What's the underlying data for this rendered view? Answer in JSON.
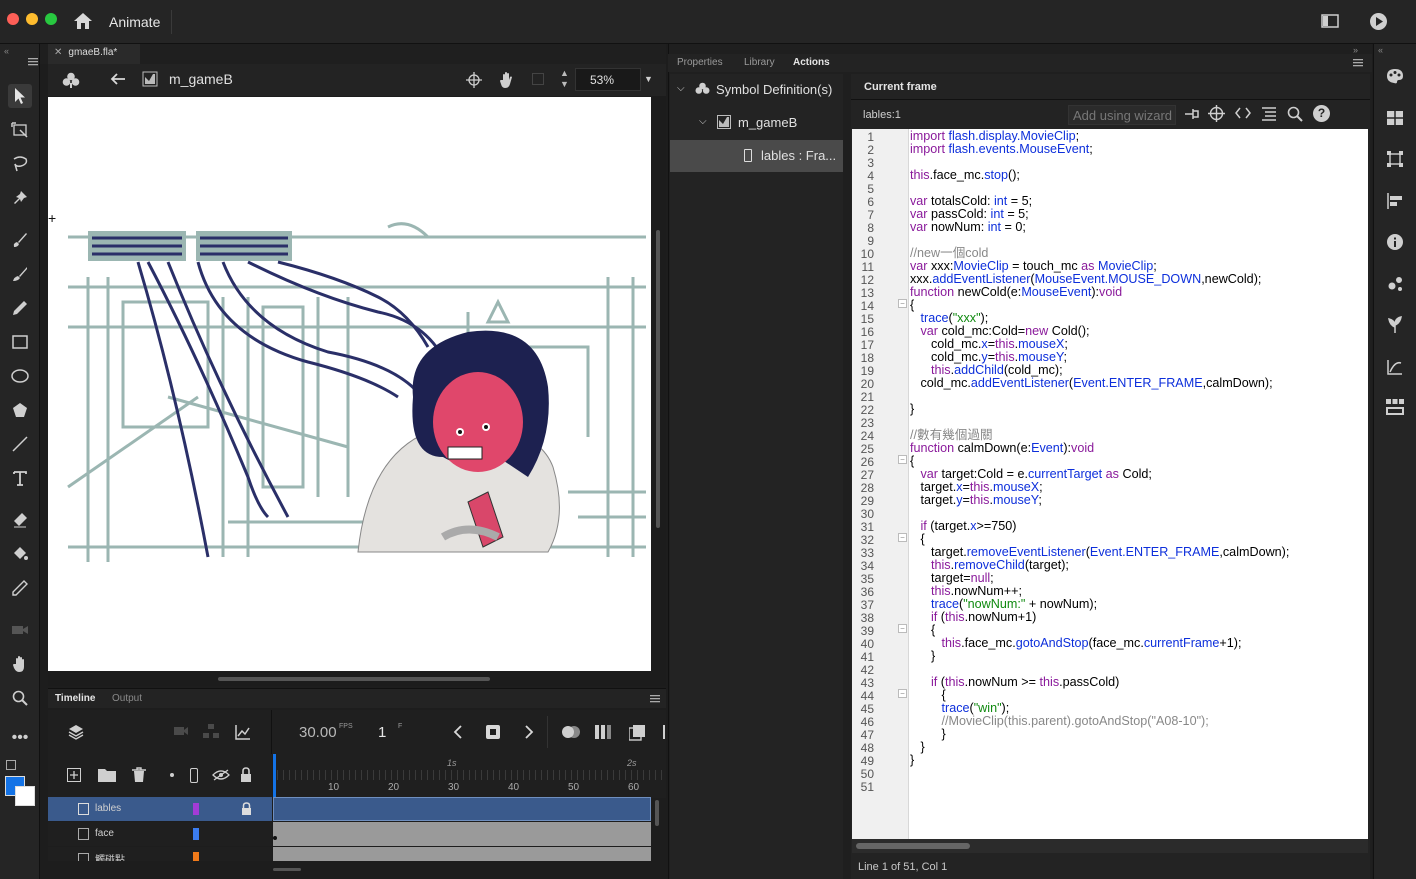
{
  "app": {
    "name": "Animate"
  },
  "document": {
    "tab": "gmaeB.fla*"
  },
  "editbar": {
    "symbol_name": "m_gameB",
    "zoom": "53%"
  },
  "timeline": {
    "tabs": [
      "Timeline",
      "Output"
    ],
    "fps": "30.00",
    "fps_unit": "FPS",
    "frame": "1",
    "frame_unit": "F",
    "ruler_seconds": [
      "1s",
      "2s"
    ],
    "ruler_frames": [
      "10",
      "20",
      "30",
      "40",
      "50",
      "60"
    ],
    "layers": [
      {
        "name": "lables",
        "color": "#a23bd6",
        "locked": true,
        "selected": true
      },
      {
        "name": "face",
        "color": "#3b7df0",
        "locked": false,
        "selected": false
      },
      {
        "name": "觸碰點",
        "color": "#f07a1a",
        "locked": false,
        "selected": false
      }
    ]
  },
  "panels": {
    "tabs": [
      "Properties",
      "Library",
      "Actions"
    ],
    "active": "Actions"
  },
  "tree": {
    "root": "Symbol Definition(s)",
    "child": "m_gameB",
    "leaf": "lables : Fra..."
  },
  "actions": {
    "header": "Current frame",
    "frame_label": "lables:1",
    "wizard": "Add using wizard",
    "status": "Line 1 of 51, Col 1",
    "line_count": 51
  },
  "code_lines": [
    [
      [
        "import ",
        "k"
      ],
      [
        "flash.display.MovieClip",
        "b"
      ],
      [
        ";",
        ""
      ]
    ],
    [
      [
        "import ",
        "k"
      ],
      [
        "flash.events.MouseEvent",
        "b"
      ],
      [
        ";",
        ""
      ]
    ],
    [],
    [
      [
        "this",
        "k"
      ],
      [
        ".face_mc.",
        ""
      ],
      [
        "stop",
        "b"
      ],
      [
        "();",
        ""
      ]
    ],
    [],
    [
      [
        "var ",
        "k"
      ],
      [
        "totalsCold: ",
        ""
      ],
      [
        "int",
        "b"
      ],
      [
        " = 5;",
        ""
      ]
    ],
    [
      [
        "var ",
        "k"
      ],
      [
        "passCold: ",
        ""
      ],
      [
        "int",
        "b"
      ],
      [
        " = 5;",
        ""
      ]
    ],
    [
      [
        "var ",
        "k"
      ],
      [
        "nowNum: ",
        ""
      ],
      [
        "int",
        "b"
      ],
      [
        " = 0;",
        ""
      ]
    ],
    [],
    [
      [
        "//new一個cold",
        "c"
      ]
    ],
    [
      [
        "var ",
        "k"
      ],
      [
        "xxx:",
        ""
      ],
      [
        "MovieClip",
        "b"
      ],
      [
        " = touch_mc ",
        ""
      ],
      [
        "as ",
        "k"
      ],
      [
        "MovieClip",
        "b"
      ],
      [
        ";",
        ""
      ]
    ],
    [
      [
        "xxx.",
        ""
      ],
      [
        "addEventListener",
        "b"
      ],
      [
        "(",
        ""
      ],
      [
        "MouseEvent.MOUSE_DOWN",
        "b"
      ],
      [
        ",newCold);",
        ""
      ]
    ],
    [
      [
        "function ",
        "k"
      ],
      [
        "newCold(e:",
        ""
      ],
      [
        "MouseEvent",
        "b"
      ],
      [
        "):",
        ""
      ],
      [
        "void",
        "k"
      ]
    ],
    [
      [
        "{",
        ""
      ]
    ],
    [
      [
        "   ",
        ""
      ],
      [
        "trace",
        "b"
      ],
      [
        "(",
        ""
      ],
      [
        "\"xxx\"",
        "g"
      ],
      [
        ");",
        ""
      ]
    ],
    [
      [
        "   ",
        ""
      ],
      [
        "var ",
        "k"
      ],
      [
        "cold_mc:Cold=",
        ""
      ],
      [
        "new ",
        "k"
      ],
      [
        "Cold();",
        ""
      ]
    ],
    [
      [
        "      cold_mc.",
        ""
      ],
      [
        "x",
        "b"
      ],
      [
        "=",
        ""
      ],
      [
        "this",
        "k"
      ],
      [
        ".",
        ""
      ],
      [
        "mouseX",
        "b"
      ],
      [
        ";",
        ""
      ]
    ],
    [
      [
        "      cold_mc.",
        ""
      ],
      [
        "y",
        "b"
      ],
      [
        "=",
        ""
      ],
      [
        "this",
        "k"
      ],
      [
        ".",
        ""
      ],
      [
        "mouseY",
        "b"
      ],
      [
        ";",
        ""
      ]
    ],
    [
      [
        "      ",
        ""
      ],
      [
        "this",
        "k"
      ],
      [
        ".",
        ""
      ],
      [
        "addChild",
        "b"
      ],
      [
        "(cold_mc);",
        ""
      ]
    ],
    [
      [
        "   cold_mc.",
        ""
      ],
      [
        "addEventListener",
        "b"
      ],
      [
        "(",
        ""
      ],
      [
        "Event.ENTER_FRAME",
        "b"
      ],
      [
        ",calmDown);",
        ""
      ]
    ],
    [],
    [
      [
        "}",
        ""
      ]
    ],
    [],
    [
      [
        "//數有幾個過關",
        "c"
      ]
    ],
    [
      [
        "function ",
        "k"
      ],
      [
        "calmDown(e:",
        ""
      ],
      [
        "Event",
        "b"
      ],
      [
        "):",
        ""
      ],
      [
        "void",
        "k"
      ]
    ],
    [
      [
        "{",
        ""
      ]
    ],
    [
      [
        "   ",
        ""
      ],
      [
        "var ",
        "k"
      ],
      [
        "target:Cold = e.",
        ""
      ],
      [
        "currentTarget ",
        "b"
      ],
      [
        "as ",
        "k"
      ],
      [
        "Cold;",
        ""
      ]
    ],
    [
      [
        "   target.",
        ""
      ],
      [
        "x",
        "b"
      ],
      [
        "=",
        ""
      ],
      [
        "this",
        "k"
      ],
      [
        ".",
        ""
      ],
      [
        "mouseX",
        "b"
      ],
      [
        ";",
        ""
      ]
    ],
    [
      [
        "   target.",
        ""
      ],
      [
        "y",
        "b"
      ],
      [
        "=",
        ""
      ],
      [
        "this",
        "k"
      ],
      [
        ".",
        ""
      ],
      [
        "mouseY",
        "b"
      ],
      [
        ";",
        ""
      ]
    ],
    [],
    [
      [
        "   ",
        ""
      ],
      [
        "if ",
        "k"
      ],
      [
        "(target.",
        ""
      ],
      [
        "x",
        "b"
      ],
      [
        ">=750)",
        ""
      ]
    ],
    [
      [
        "   {",
        ""
      ]
    ],
    [
      [
        "      target.",
        ""
      ],
      [
        "removeEventListener",
        "b"
      ],
      [
        "(",
        ""
      ],
      [
        "Event.ENTER_FRAME",
        "b"
      ],
      [
        ",calmDown);",
        ""
      ]
    ],
    [
      [
        "      ",
        ""
      ],
      [
        "this",
        "k"
      ],
      [
        ".",
        ""
      ],
      [
        "removeChild",
        "b"
      ],
      [
        "(target);",
        ""
      ]
    ],
    [
      [
        "      target=",
        ""
      ],
      [
        "null",
        "k"
      ],
      [
        ";",
        ""
      ]
    ],
    [
      [
        "      ",
        ""
      ],
      [
        "this",
        "k"
      ],
      [
        ".nowNum++;",
        ""
      ]
    ],
    [
      [
        "      ",
        ""
      ],
      [
        "trace",
        "b"
      ],
      [
        "(",
        ""
      ],
      [
        "\"nowNum:\"",
        "g"
      ],
      [
        " + nowNum);",
        ""
      ]
    ],
    [
      [
        "      ",
        ""
      ],
      [
        "if ",
        "k"
      ],
      [
        "(",
        ""
      ],
      [
        "this",
        "k"
      ],
      [
        ".nowNum+1)",
        ""
      ]
    ],
    [
      [
        "      {",
        ""
      ]
    ],
    [
      [
        "         ",
        ""
      ],
      [
        "this",
        "k"
      ],
      [
        ".face_mc.",
        ""
      ],
      [
        "gotoAndStop",
        "b"
      ],
      [
        "(face_mc.",
        ""
      ],
      [
        "currentFrame",
        "b"
      ],
      [
        "+1);",
        ""
      ]
    ],
    [
      [
        "      }",
        ""
      ]
    ],
    [],
    [
      [
        "      ",
        ""
      ],
      [
        "if ",
        "k"
      ],
      [
        "(",
        ""
      ],
      [
        "this",
        "k"
      ],
      [
        ".nowNum >= ",
        ""
      ],
      [
        "this",
        "k"
      ],
      [
        ".passCold)",
        ""
      ]
    ],
    [
      [
        "         {",
        ""
      ]
    ],
    [
      [
        "         ",
        ""
      ],
      [
        "trace",
        "b"
      ],
      [
        "(",
        ""
      ],
      [
        "\"win\"",
        "g"
      ],
      [
        ");",
        ""
      ]
    ],
    [
      [
        "         //MovieClip(this.parent).gotoAndStop(\"A08-10\");",
        "c"
      ]
    ],
    [
      [
        "         }",
        ""
      ]
    ],
    [
      [
        "   }",
        ""
      ]
    ],
    [
      [
        "}",
        ""
      ]
    ],
    [],
    []
  ]
}
